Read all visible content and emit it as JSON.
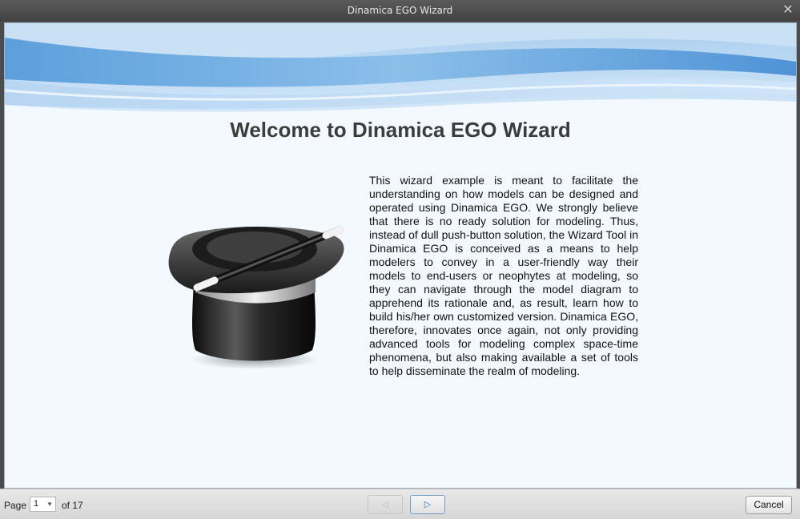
{
  "window": {
    "title": "Dinamica EGO Wizard",
    "close_glyph": "✕"
  },
  "page": {
    "heading": "Welcome to Dinamica EGO Wizard",
    "description": "This wizard example is meant to facilitate the understanding on how models can be designed and operated using Dinamica EGO. We strongly believe that there is no ready solution for modeling. Thus, instead of dull push-button solution, the Wizard Tool in Dinamica EGO is conceived as a means to help modelers to convey in a user-friendly way their models to end-users or neophytes at modeling, so they can navigate through the model diagram to apprehend its rationale and, as result, learn how to build his/her own customized version. Dinamica EGO, therefore, innovates once again, not only providing advanced tools for modeling complex space-time phenomena, but also making available a set of tools to help disseminate the realm of modeling.",
    "illustration_icon": "magic-hat-with-wand-icon"
  },
  "footer": {
    "page_label": "Page",
    "current_page": "1",
    "of_label": "of 17",
    "prev_glyph": "◁",
    "next_glyph": "▷",
    "cancel_label": "Cancel"
  },
  "colors": {
    "titlebar": "#4c4c4c",
    "content_bg": "#f3f9fe",
    "banner_blue": "#6aa8e0",
    "accent_blue": "#2d6fb5"
  }
}
